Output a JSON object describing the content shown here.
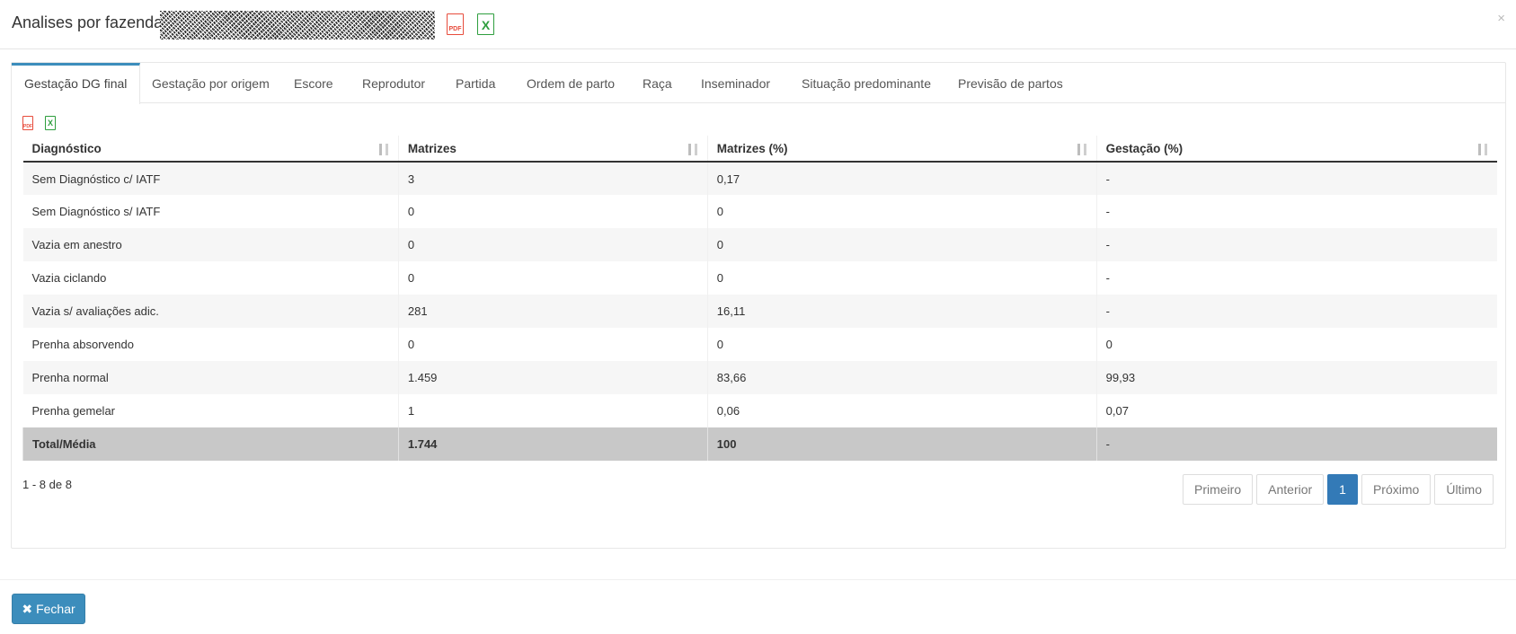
{
  "modal": {
    "title": "Analises por fazendas",
    "close_symbol": "×"
  },
  "header_icons": {
    "pdf_label": "PDF",
    "xls_label": "X"
  },
  "tabs": [
    "Gestação DG final",
    "Gestação por origem",
    "Escore",
    "Reprodutor",
    "Partida",
    "Ordem de parto",
    "Raça",
    "Inseminador",
    "Situação predominante",
    "Previsão de partos"
  ],
  "export_icons": {
    "pdf_label": "PDF",
    "xls_label": "X"
  },
  "table": {
    "columns": [
      "Diagnóstico",
      "Matrizes",
      "Matrizes (%)",
      "Gestação (%)"
    ],
    "rows": [
      [
        "Sem Diagnóstico c/ IATF",
        "3",
        "0,17",
        "-"
      ],
      [
        "Sem Diagnóstico s/ IATF",
        "0",
        "0",
        "-"
      ],
      [
        "Vazia em anestro",
        "0",
        "0",
        "-"
      ],
      [
        "Vazia ciclando",
        "0",
        "0",
        "-"
      ],
      [
        "Vazia s/ avaliações adic.",
        "281",
        "16,11",
        "-"
      ],
      [
        "Prenha absorvendo",
        "0",
        "0",
        "0"
      ],
      [
        "Prenha normal",
        "1.459",
        "83,66",
        "99,93"
      ],
      [
        "Prenha gemelar",
        "1",
        "0,06",
        "0,07"
      ]
    ],
    "total": [
      "Total/Média",
      "1.744",
      "100",
      "-"
    ]
  },
  "pagination": {
    "range_text": "1 - 8 de 8",
    "first": "Primeiro",
    "prev": "Anterior",
    "current": "1",
    "next": "Próximo",
    "last": "Último"
  },
  "footer": {
    "close_label": "Fechar",
    "close_icon": "✖"
  },
  "colors": {
    "accent": "#3c8dbc",
    "pdf": "#e74c3c",
    "xls": "#2e9e3e",
    "active_page": "#337ab7"
  }
}
